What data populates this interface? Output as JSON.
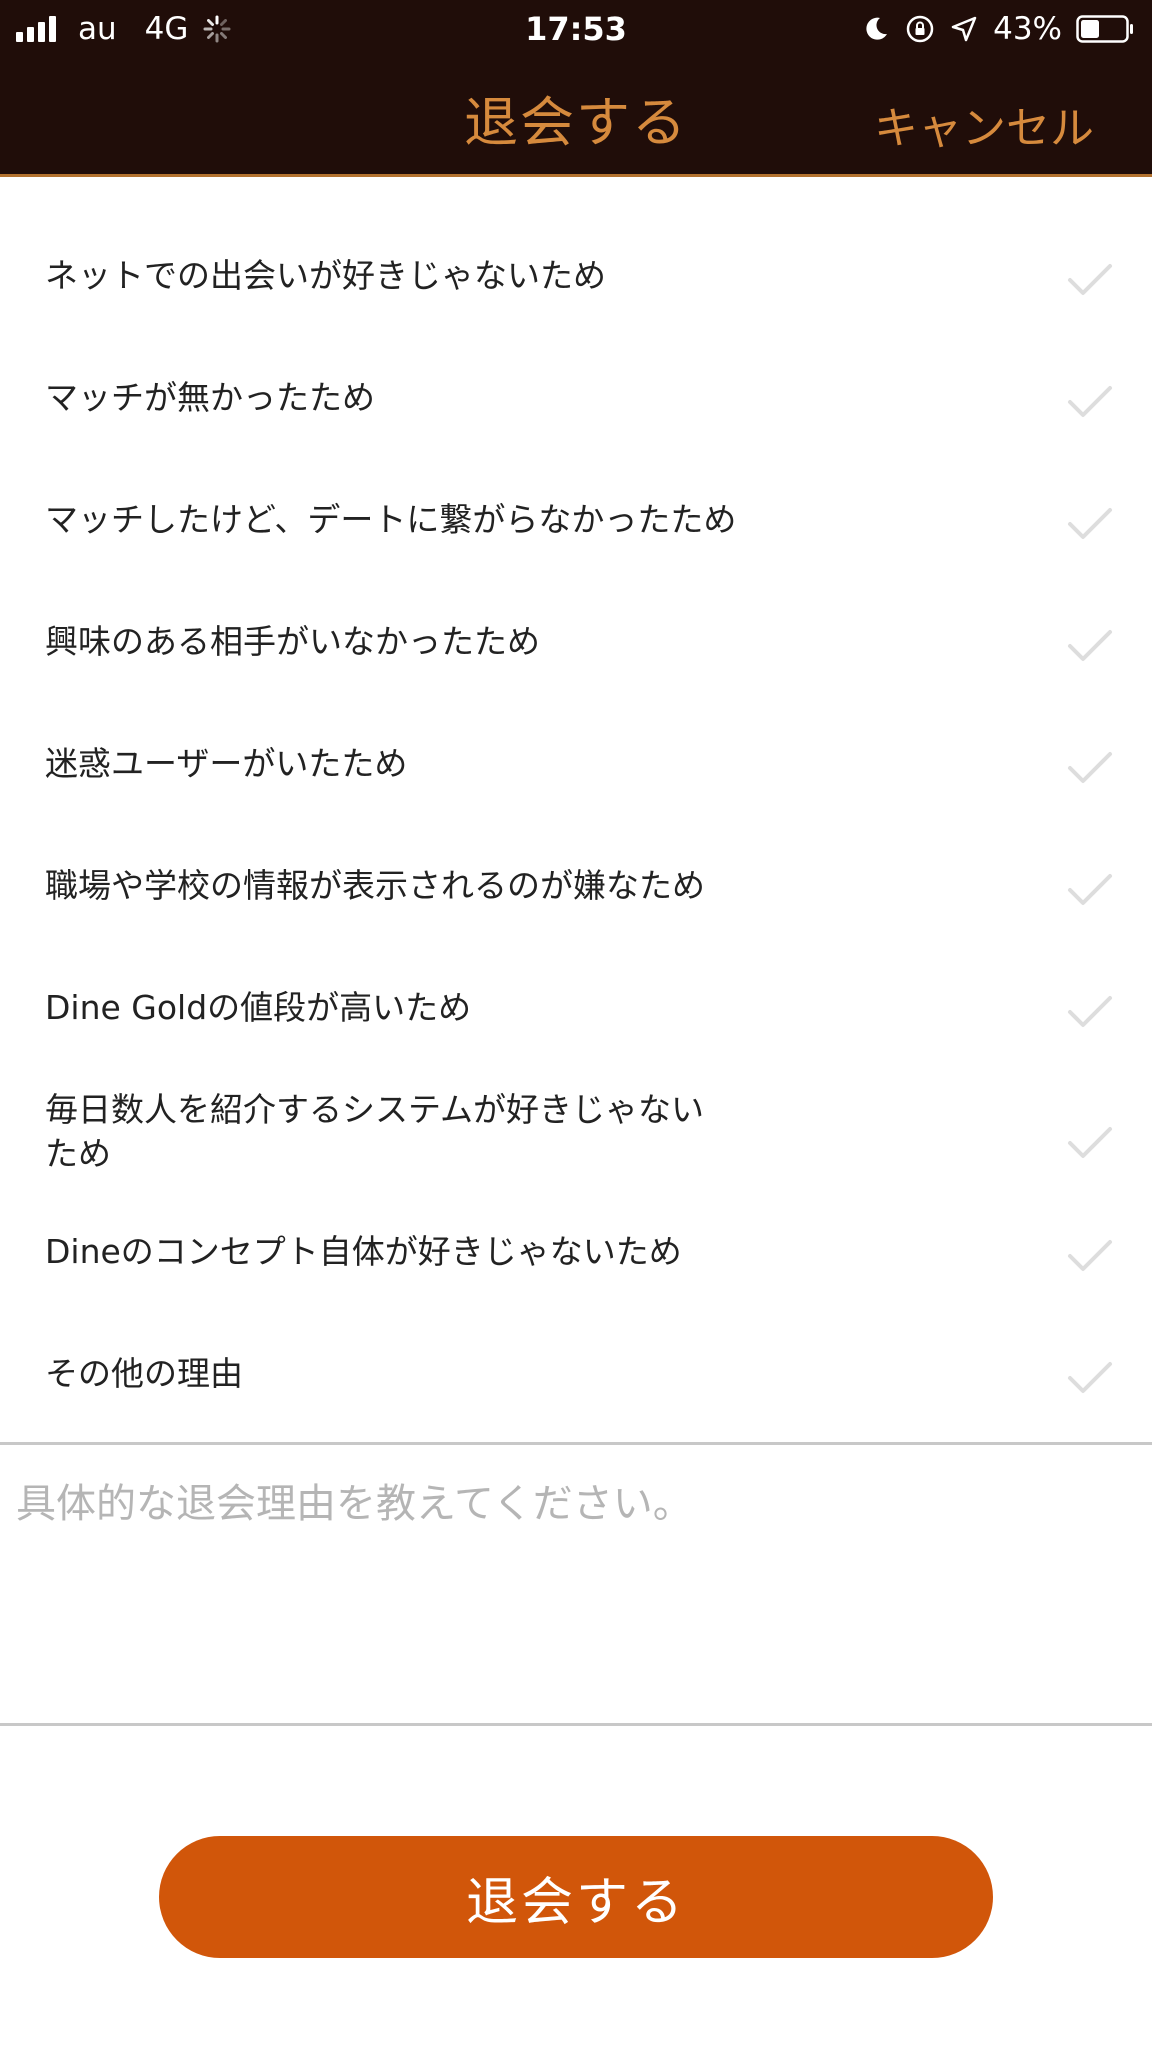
{
  "status_bar": {
    "carrier": "au",
    "network": "4G",
    "time": "17:53",
    "battery": "43%",
    "battery_level": 0.43
  },
  "header": {
    "title": "退会する",
    "cancel_label": "キャンセル"
  },
  "reasons": [
    {
      "label": "ネットでの出会いが好きじゃないため",
      "checked": false
    },
    {
      "label": "マッチが無かったため",
      "checked": false
    },
    {
      "label": "マッチしたけど、デートに繋がらなかったため",
      "checked": false
    },
    {
      "label": "興味のある相手がいなかったため",
      "checked": false
    },
    {
      "label": "迷惑ユーザーがいたため",
      "checked": false
    },
    {
      "label": "職場や学校の情報が表示されるのが嫌なため",
      "checked": false
    },
    {
      "label": "Dine Goldの値段が高いため",
      "checked": false
    },
    {
      "label": "毎日数人を紹介するシステムが好きじゃない\nため",
      "checked": false
    },
    {
      "label": "Dineのコンセプト自体が好きじゃないため",
      "checked": false
    },
    {
      "label": "その他の理由",
      "checked": false
    }
  ],
  "detail": {
    "placeholder": "具体的な退会理由を教えてください。",
    "value": ""
  },
  "submit": {
    "label": "退会する"
  },
  "colors": {
    "header_bg": "#200d09",
    "accent": "#d68a3d",
    "button": "#d1560a",
    "check": "#dddddd"
  }
}
